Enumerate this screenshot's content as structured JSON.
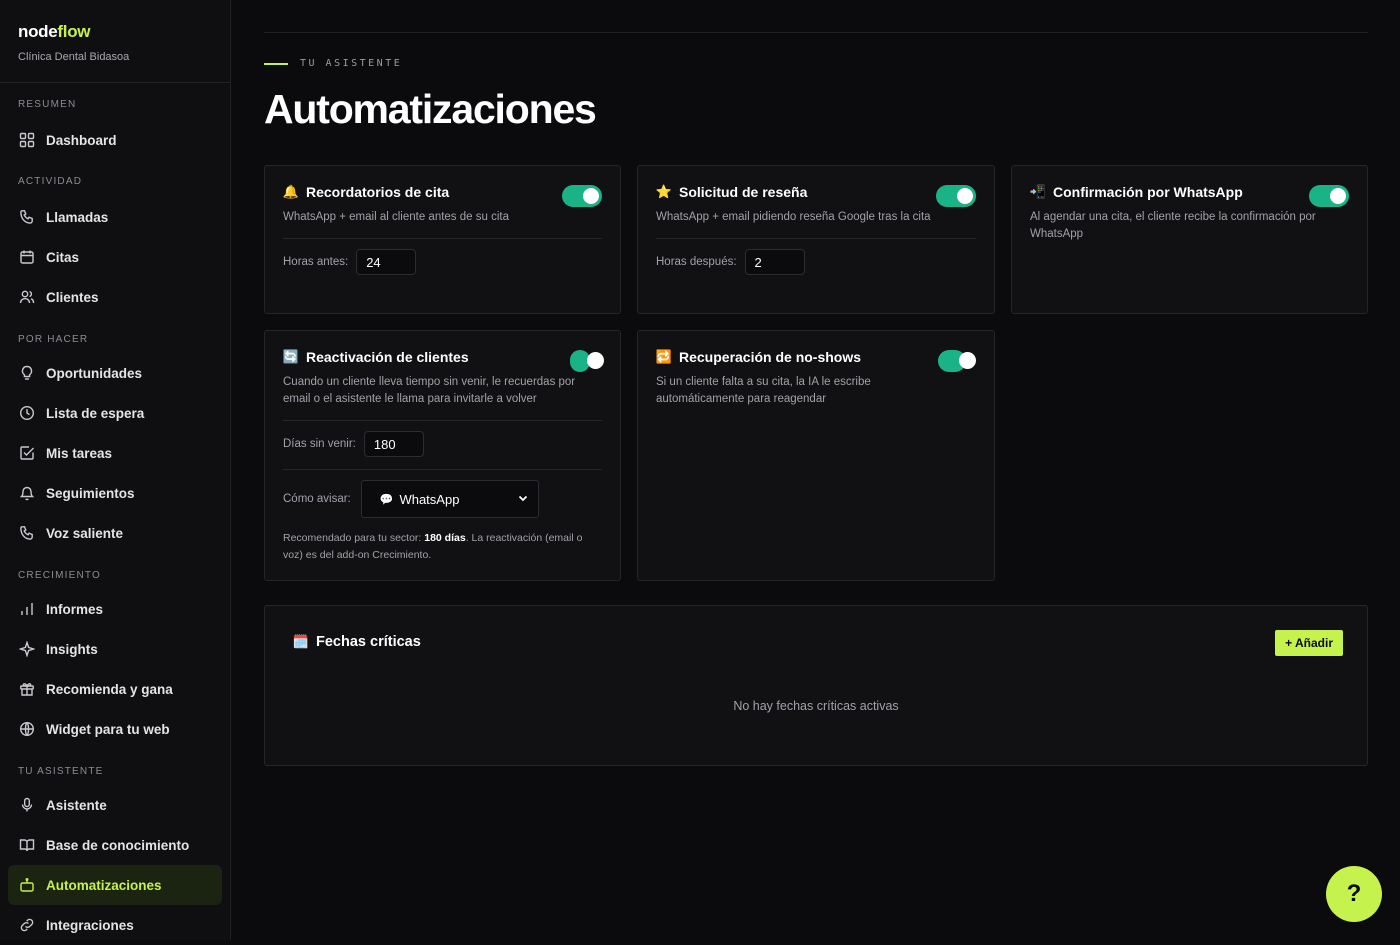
{
  "brand": {
    "name_main": "node",
    "name_accent": "flow",
    "clinic": "Clínica Dental Bidasoa"
  },
  "sidebar": {
    "sections": [
      {
        "label": "RESUMEN",
        "items": [
          {
            "label": "Dashboard",
            "icon": "grid-icon"
          }
        ]
      },
      {
        "label": "ACTIVIDAD",
        "items": [
          {
            "label": "Llamadas",
            "icon": "phone-icon"
          },
          {
            "label": "Citas",
            "icon": "calendar-icon"
          },
          {
            "label": "Clientes",
            "icon": "users-icon"
          }
        ]
      },
      {
        "label": "POR HACER",
        "items": [
          {
            "label": "Oportunidades",
            "icon": "lightbulb-icon"
          },
          {
            "label": "Lista de espera",
            "icon": "clock-icon"
          },
          {
            "label": "Mis tareas",
            "icon": "checkbox-icon"
          },
          {
            "label": "Seguimientos",
            "icon": "bell-icon"
          },
          {
            "label": "Voz saliente",
            "icon": "phone-icon"
          }
        ]
      },
      {
        "label": "CRECIMIENTO",
        "items": [
          {
            "label": "Informes",
            "icon": "bar-chart-icon"
          },
          {
            "label": "Insights",
            "icon": "sparkle-icon"
          },
          {
            "label": "Recomienda y gana",
            "icon": "gift-icon"
          },
          {
            "label": "Widget para tu web",
            "icon": "globe-icon"
          }
        ]
      },
      {
        "label": "TU ASISTENTE",
        "items": [
          {
            "label": "Asistente",
            "icon": "mic-icon"
          },
          {
            "label": "Base de conocimiento",
            "icon": "book-icon"
          },
          {
            "label": "Automatizaciones",
            "icon": "robot-icon",
            "active": true
          },
          {
            "label": "Integraciones",
            "icon": "link-icon"
          }
        ]
      }
    ]
  },
  "header": {
    "eyebrow": "TU ASISTENTE",
    "title": "Automatizaciones"
  },
  "cards": {
    "recordatorios": {
      "title": "Recordatorios de cita",
      "icon": "bell-emoji-icon",
      "desc": "WhatsApp + email al cliente antes de su cita",
      "field_label": "Horas antes:",
      "field_value": "24",
      "enabled": true
    },
    "resena": {
      "title": "Solicitud de reseña",
      "icon": "star-emoji-icon",
      "desc": "WhatsApp + email pidiendo reseña Google tras la cita",
      "field_label": "Horas después:",
      "field_value": "2",
      "enabled": true
    },
    "confirmacion": {
      "title": "Confirmación por WhatsApp",
      "icon": "incoming-envelope-icon",
      "desc": "Al agendar una cita, el cliente recibe la confirmación por WhatsApp",
      "enabled": true
    },
    "reactivacion": {
      "title": "Reactivación de clientes",
      "icon": "refresh-emoji-icon",
      "desc": "Cuando un cliente lleva tiempo sin venir, le recuerdas por email o el asistente le llama para invitarle a volver",
      "field_label": "Días sin venir:",
      "field_value": "180",
      "channel_label": "Cómo avisar:",
      "channel_value": "WhatsApp",
      "channel_icon": "speech-bubble-icon",
      "rec_prefix": "Recomendado para tu sector: ",
      "rec_bold": "180 días",
      "rec_suffix": ". La reactivación (email o voz) es del add-on Crecimiento.",
      "enabled": true
    },
    "noshows": {
      "title": "Recuperación de no-shows",
      "icon": "repeat-emoji-icon",
      "desc": "Si un cliente falta a su cita, la IA le escribe automáticamente para reagendar",
      "enabled": true
    }
  },
  "critical": {
    "title": "Fechas críticas",
    "icon": "calendar-emoji-icon",
    "add_label": "+ Añadir",
    "empty": "No hay fechas críticas activas"
  },
  "help": {
    "label": "?"
  },
  "colors": {
    "accent": "#c6f24e",
    "toggle_on": "#1ab387",
    "background": "#0b0b0d"
  }
}
